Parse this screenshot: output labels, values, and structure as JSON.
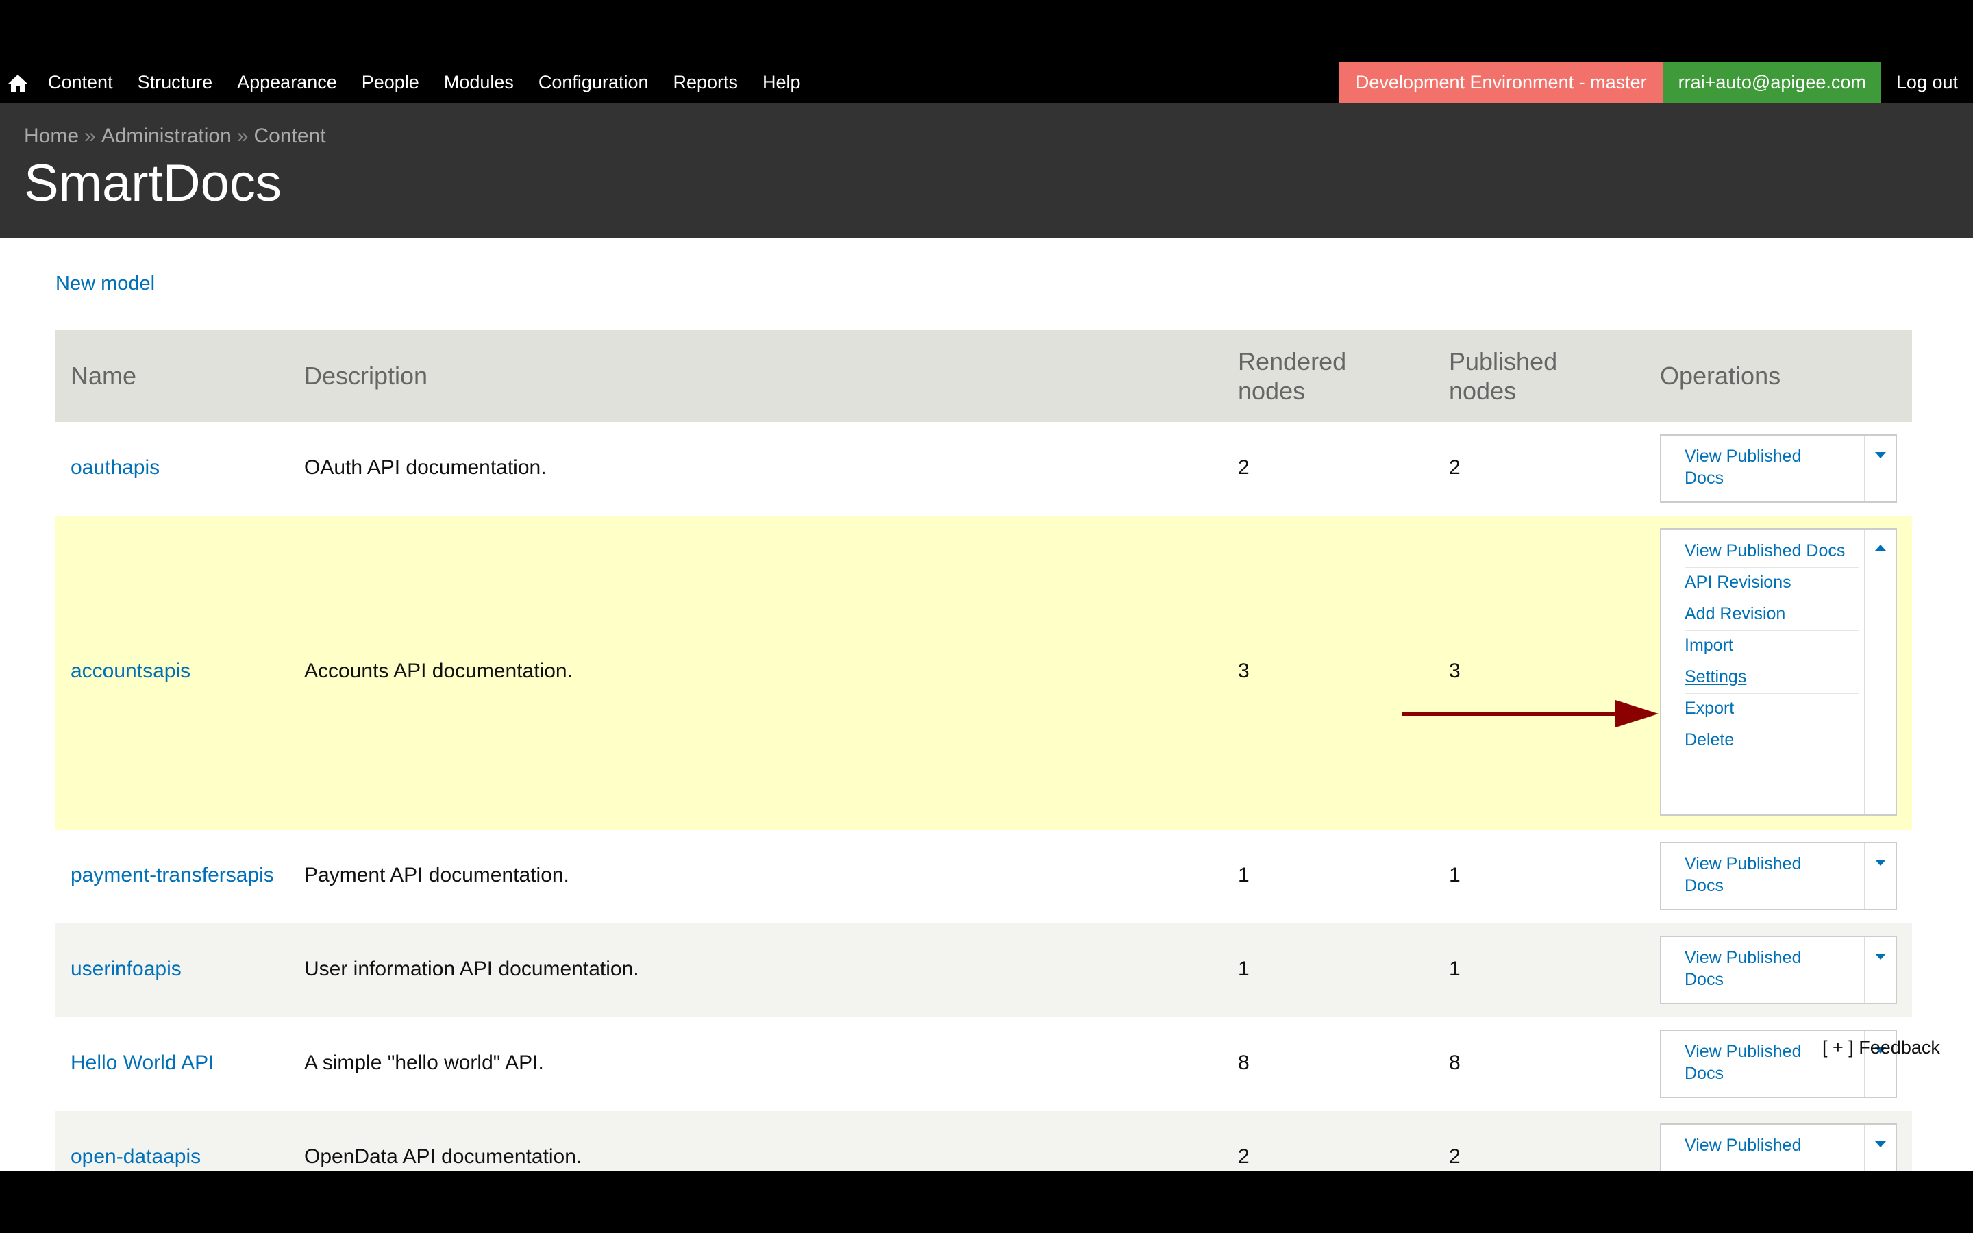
{
  "toolbar": {
    "menu": [
      "Content",
      "Structure",
      "Appearance",
      "People",
      "Modules",
      "Configuration",
      "Reports",
      "Help"
    ],
    "environment": "Development Environment - master",
    "user": "rrai+auto@apigee.com",
    "logout": "Log out",
    "home_icon": "home-icon"
  },
  "header": {
    "breadcrumb": [
      "Home",
      "Administration",
      "Content"
    ],
    "breadcrumb_sep": "»",
    "title": "SmartDocs"
  },
  "actions": {
    "new_model": "New model"
  },
  "table": {
    "headers": {
      "name": "Name",
      "description": "Description",
      "rendered_1": "Rendered",
      "rendered_2": "nodes",
      "published_1": "Published",
      "published_2": "nodes",
      "operations": "Operations"
    },
    "rows": [
      {
        "name": "oauthapis",
        "description": "OAuth API documentation.",
        "rendered": "2",
        "published": "2",
        "op_1": "View Published",
        "op_2": "Docs"
      },
      {
        "name": "accountsapis",
        "description": "Accounts API documentation.",
        "rendered": "3",
        "published": "3",
        "menu": [
          "View Published Docs",
          "API Revisions",
          "Add Revision",
          "Import",
          "Settings",
          "Export",
          "Delete"
        ]
      },
      {
        "name": "payment-transfersapis",
        "description": "Payment API documentation.",
        "rendered": "1",
        "published": "1",
        "op_1": "View Published",
        "op_2": "Docs"
      },
      {
        "name": "userinfoapis",
        "description": "User information API documentation.",
        "rendered": "1",
        "published": "1",
        "op_1": "View Published",
        "op_2": "Docs"
      },
      {
        "name": "Hello World API",
        "description": "A simple \"hello world\" API.",
        "rendered": "8",
        "published": "8",
        "op_1": "View Published",
        "op_2": "Docs"
      },
      {
        "name": "open-dataapis",
        "description": "OpenData API documentation.",
        "rendered": "2",
        "published": "2",
        "op_1": "View Published",
        "op_2": ""
      }
    ]
  },
  "feedback": "[ + ] Feedback",
  "colors": {
    "link": "#0071b8",
    "env": "#f2716a",
    "user": "#3f9a3a",
    "highlight_row": "#ffffc8",
    "arrow": "#8b0000"
  }
}
